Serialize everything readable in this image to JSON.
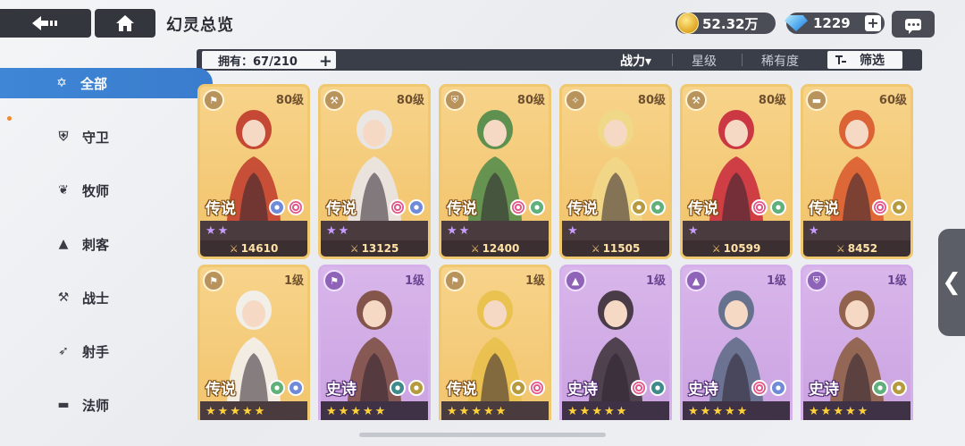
{
  "header": {
    "title": "幻灵总览",
    "gold": "52.32万",
    "gems": "1229"
  },
  "filterbar": {
    "owned": "拥有：67/210",
    "sort_power": "战力",
    "sort_power_arrow": "▾",
    "sort_stars": "星级",
    "sort_rarity": "稀有度",
    "filter": "筛选"
  },
  "sidebar": {
    "items": [
      {
        "label": "全部",
        "icon": "all-star-icon",
        "active": true
      },
      {
        "label": "守卫",
        "icon": "guard-shield-icon"
      },
      {
        "label": "牧师",
        "icon": "priest-wings-icon"
      },
      {
        "label": "刺客",
        "icon": "assassin-icon"
      },
      {
        "label": "战士",
        "icon": "warrior-axe-icon"
      },
      {
        "label": "射手",
        "icon": "archer-bow-icon"
      },
      {
        "label": "法师",
        "icon": "mage-book-icon"
      }
    ]
  },
  "cards": [
    {
      "level": "80级",
      "rarity": "传说",
      "power": "14610",
      "stars": 2,
      "frame": "gold",
      "traits": [
        "star",
        "spiral"
      ],
      "accent": "#c0392b"
    },
    {
      "level": "80级",
      "rarity": "传说",
      "power": "13125",
      "stars": 2,
      "frame": "gold",
      "traits": [
        "spiral",
        "star"
      ],
      "accent": "#e8e8ee"
    },
    {
      "level": "80级",
      "rarity": "传说",
      "power": "12400",
      "stars": 2,
      "frame": "gold",
      "traits": [
        "spiral",
        "leaf"
      ],
      "accent": "#4e8a4a"
    },
    {
      "level": "80级",
      "rarity": "传说",
      "power": "11505",
      "stars": 1,
      "frame": "gold",
      "traits": [
        "wing",
        "leaf"
      ],
      "accent": "#f0d88a"
    },
    {
      "level": "80级",
      "rarity": "传说",
      "power": "10599",
      "stars": 1,
      "frame": "gold",
      "traits": [
        "spiral",
        "leaf"
      ],
      "accent": "#c7263b"
    },
    {
      "level": "60级",
      "rarity": "传说",
      "power": "8452",
      "stars": 1,
      "frame": "gold",
      "traits": [
        "spiral",
        "wing"
      ],
      "accent": "#d9562d"
    },
    {
      "level": "1级",
      "rarity": "传说",
      "stars": 5,
      "frame": "gold",
      "traits": [
        "leaf",
        "star"
      ],
      "accent": "#f2f2f4"
    },
    {
      "level": "1级",
      "rarity": "史诗",
      "stars": 5,
      "frame": "purple",
      "traits": [
        "dark",
        "wing"
      ],
      "accent": "#7a4a3a"
    },
    {
      "level": "1级",
      "rarity": "传说",
      "stars": 5,
      "frame": "gold",
      "traits": [
        "wing",
        "spiral"
      ],
      "accent": "#e8c04a"
    },
    {
      "level": "1级",
      "rarity": "史诗",
      "stars": 5,
      "frame": "purple",
      "traits": [
        "spiral",
        "dark"
      ],
      "accent": "#3a2f35"
    },
    {
      "level": "1级",
      "rarity": "史诗",
      "stars": 5,
      "frame": "purple",
      "traits": [
        "spiral",
        "star"
      ],
      "accent": "#5a6a84"
    },
    {
      "level": "1级",
      "rarity": "史诗",
      "stars": 5,
      "frame": "purple",
      "traits": [
        "leaf",
        "wing"
      ],
      "accent": "#8a5a3c"
    }
  ]
}
